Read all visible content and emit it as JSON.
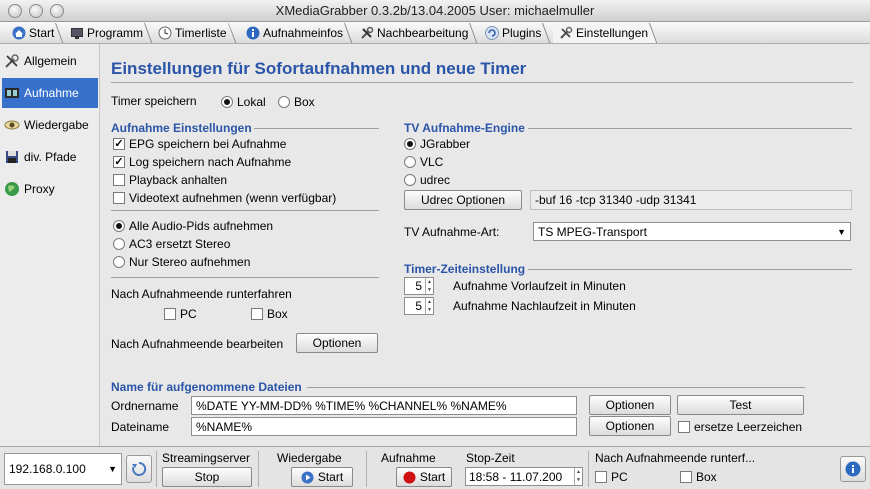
{
  "window": {
    "title": "XMediaGrabber 0.3.2b/13.04.2005 User: michaelmuller"
  },
  "tabs": [
    {
      "label": "Start",
      "icon": "home-icon"
    },
    {
      "label": "Programm",
      "icon": "monitor-icon"
    },
    {
      "label": "Timerliste",
      "icon": "clock-icon"
    },
    {
      "label": "Aufnahmeinfos",
      "icon": "info-icon"
    },
    {
      "label": "Nachbearbeitung",
      "icon": "tools-icon"
    },
    {
      "label": "Plugins",
      "icon": "plugin-icon"
    },
    {
      "label": "Einstellungen",
      "icon": "wrench-icon"
    }
  ],
  "sidebar": {
    "items": [
      {
        "label": "Allgemein",
        "icon": "wrench-icon"
      },
      {
        "label": "Aufnahme",
        "icon": "film-icon"
      },
      {
        "label": "Wiedergabe",
        "icon": "eye-icon"
      },
      {
        "label": "div. Pfade",
        "icon": "disk-icon"
      },
      {
        "label": "Proxy",
        "icon": "globe-icon"
      }
    ],
    "active": "Aufnahme"
  },
  "main": {
    "heading": "Einstellungen für Sofortaufnahmen und neue Timer",
    "timer_save": {
      "label": "Timer speichern",
      "opt_local": "Lokal",
      "opt_box": "Box",
      "selected": "Lokal"
    },
    "rec_settings": {
      "title": "Aufnahme Einstellungen",
      "checkboxes": [
        {
          "label": "EPG speichern bei Aufnahme",
          "checked": true
        },
        {
          "label": "Log speichern nach Aufnahme",
          "checked": true
        },
        {
          "label": "Playback anhalten",
          "checked": false
        },
        {
          "label": "Videotext aufnehmen (wenn verfügbar)",
          "checked": false
        }
      ],
      "audio_radios": [
        {
          "label": "Alle Audio-Pids aufnehmen",
          "checked": true
        },
        {
          "label": "AC3 ersetzt Stereo",
          "checked": false
        },
        {
          "label": "Nur Stereo aufnehmen",
          "checked": false
        }
      ],
      "shutdown_label": "Nach Aufnahmeende runterfahren",
      "shutdown_pc": "PC",
      "shutdown_box": "Box",
      "postprocess_label": "Nach Aufnahmeende bearbeiten",
      "postprocess_button": "Optionen"
    },
    "engine": {
      "title": "TV Aufnahme-Engine",
      "options": [
        {
          "label": "JGrabber",
          "checked": true
        },
        {
          "label": "VLC",
          "checked": false
        },
        {
          "label": "udrec",
          "checked": false
        }
      ],
      "udrec_button": "Udrec Optionen",
      "udrec_args": "-buf 16 -tcp 31340 -udp 31341",
      "type_label": "TV Aufnahme-Art:",
      "type_value": "TS MPEG-Transport"
    },
    "timer_time": {
      "title": "Timer-Zeiteinstellung",
      "pre_value": "5",
      "pre_label": "Aufnahme Vorlaufzeit in Minuten",
      "post_value": "5",
      "post_label": "Aufnahme Nachlaufzeit in Minuten"
    },
    "files": {
      "title": "Name für aufgenommene Dateien",
      "folder_label": "Ordnername",
      "folder_value": "%DATE YY-MM-DD% %TIME% %CHANNEL% %NAME%",
      "folder_button": "Optionen",
      "test_button": "Test",
      "file_label": "Dateiname",
      "file_value": "%NAME%",
      "file_button": "Optionen",
      "replace_spaces": "ersetze Leerzeichen"
    }
  },
  "status": {
    "ip": "192.168.0.100",
    "streaming_label": "Streamingserver",
    "streaming_button": "Stop",
    "playback_label": "Wiedergabe",
    "playback_button": "Start",
    "record_label": "Aufnahme",
    "record_button": "Start",
    "stop_time_label": "Stop-Zeit",
    "stop_time_value": "18:58 - 11.07.200",
    "shutdown_label": "Nach Aufnahmeende runterf...",
    "pc_label": "PC",
    "box_label": "Box"
  },
  "colors": {
    "accent": "#2a55a8",
    "selection": "#3771cc",
    "record": "#d01010"
  }
}
